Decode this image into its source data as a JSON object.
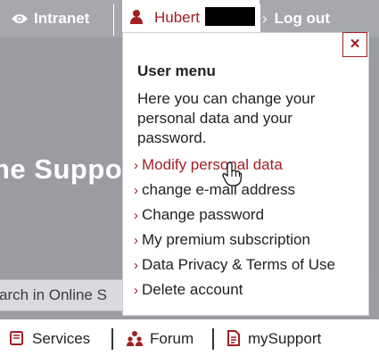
{
  "header": {
    "intranet_label": "Intranet",
    "user_name": "Hubert",
    "logout_label": "Log out"
  },
  "hero": {
    "title_fragment": "ne Suppo"
  },
  "search": {
    "placeholder": "arch in Online S"
  },
  "user_menu": {
    "close_label": "×",
    "title": "User menu",
    "description": "Here you can change your personal data and your password.",
    "items": [
      {
        "label": "Modify personal data",
        "active": true
      },
      {
        "label": "change e-mail address"
      },
      {
        "label": "Change password"
      },
      {
        "label": "My premium subscription"
      },
      {
        "label": "Data Privacy & Terms of Use"
      },
      {
        "label": "Delete account"
      }
    ]
  },
  "footer_nav": {
    "items": [
      {
        "label": "Services",
        "icon": "book-icon"
      },
      {
        "label": "Forum",
        "icon": "people-icon"
      },
      {
        "label": "mySupport",
        "icon": "document-icon"
      }
    ]
  },
  "colors": {
    "accent": "#a31f24",
    "header_gray": "#a6a8ad"
  }
}
